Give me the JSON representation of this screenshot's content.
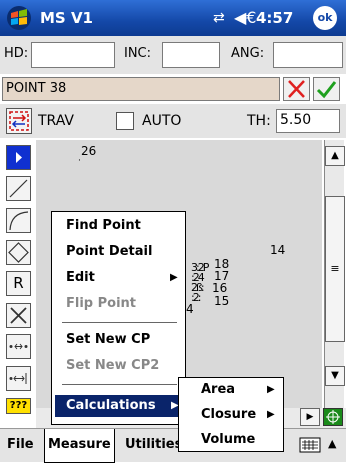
{
  "title_bar": {
    "app_title": "MS V1",
    "clock": "4:57",
    "ok_label": "ok",
    "volume_glyph": "◀€"
  },
  "inputs": {
    "hd_label": "HD:",
    "hd_value": "",
    "inc_label": "INC:",
    "inc_value": "",
    "ang_label": "ANG:",
    "ang_value": ""
  },
  "point": {
    "value": "POINT 38"
  },
  "trav_row": {
    "trav_label": "TRAV",
    "auto_label": "AUTO",
    "th_label": "TH:",
    "th_value": "5.50"
  },
  "tools": {
    "r_label": "R",
    "dots_label": "???"
  },
  "canvas_points": [
    {
      "label": "26"
    },
    {
      "label": "14"
    },
    {
      "label": "18"
    },
    {
      "label": "17"
    },
    {
      "label": "16"
    },
    {
      "label": "15"
    },
    {
      "label": "4"
    }
  ],
  "popup_menu": {
    "items": [
      {
        "label": "Find Point",
        "enabled": true
      },
      {
        "label": "Point Detail",
        "enabled": true
      },
      {
        "label": "Edit",
        "enabled": true,
        "submenu": true
      },
      {
        "label": "Flip Point",
        "enabled": false
      },
      {
        "label": "Set New CP",
        "enabled": true
      },
      {
        "label": "Set New CP2",
        "enabled": false
      },
      {
        "label": "Calculations",
        "enabled": true,
        "submenu": true,
        "highlighted": true
      }
    ]
  },
  "submenu": {
    "items": [
      {
        "label": "Area",
        "submenu": true
      },
      {
        "label": "Closure",
        "submenu": true
      },
      {
        "label": "Volume",
        "submenu": false
      }
    ]
  },
  "menubar": {
    "tabs": [
      {
        "label": "File"
      },
      {
        "label": "Measure",
        "active": true
      },
      {
        "label": "Utilities"
      }
    ]
  },
  "colors": {
    "title_bar": "#1448a8",
    "highlight": "#0a246a",
    "point_field": "#e5d7c9",
    "canvas": "#d9d9d9"
  }
}
